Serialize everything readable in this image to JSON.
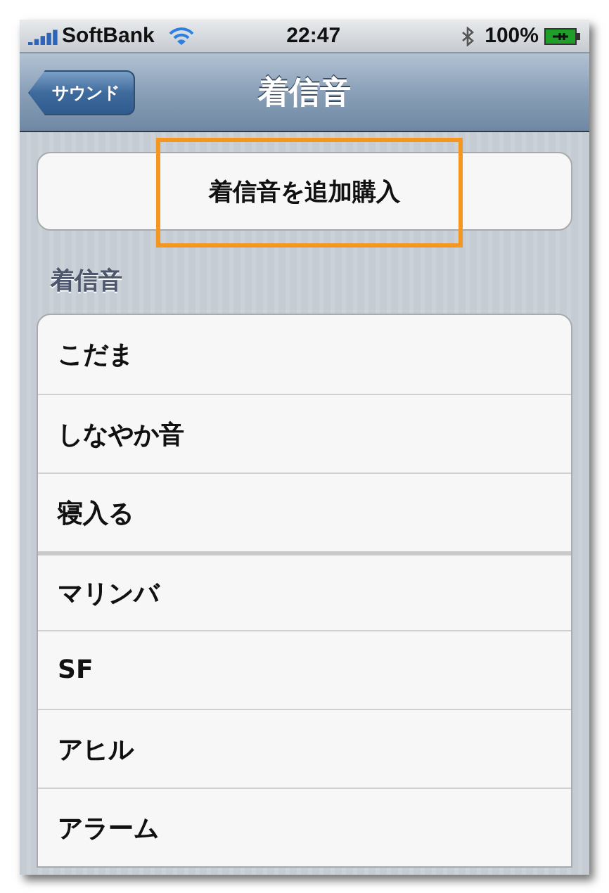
{
  "status_bar": {
    "carrier": "SoftBank",
    "time": "22:47",
    "battery": "100%"
  },
  "nav": {
    "back": "サウンド",
    "title": "着信音"
  },
  "purchase": {
    "label": "着信音を追加購入",
    "highlighted": true
  },
  "section_header": "着信音",
  "groups": [
    {
      "items": [
        "こだま",
        "しなやか音",
        "寝入る"
      ]
    },
    {
      "items": [
        "マリンバ",
        "SF",
        "アヒル",
        "アラーム"
      ]
    }
  ]
}
